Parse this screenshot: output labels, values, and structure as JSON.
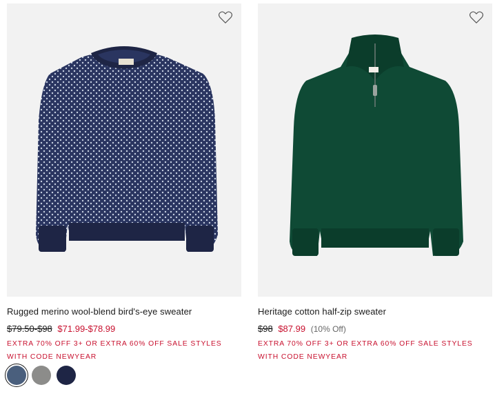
{
  "products": [
    {
      "name": "Rugged merino wool-blend bird's-eye sweater",
      "original_price": "$79.50-$98",
      "sale_price": "$71.99-$78.99",
      "discount": "",
      "promo": "EXTRA 70% OFF 3+ OR EXTRA 60% OFF SALE STYLES WITH CODE NEWYEAR",
      "image_icon": "navy-birdseye-crewneck-sweater-image",
      "swatches": [
        {
          "color": "#4a5f7d",
          "selected": true
        },
        {
          "color": "#8c8c8a",
          "selected": false
        },
        {
          "color": "#1e2545",
          "selected": false
        }
      ]
    },
    {
      "name": "Heritage cotton half-zip sweater",
      "original_price": "$98",
      "sale_price": "$87.99",
      "discount": "(10% Off)",
      "promo": "EXTRA 70% OFF 3+ OR EXTRA 60% OFF SALE STYLES WITH CODE NEWYEAR",
      "image_icon": "green-half-zip-sweater-image",
      "swatches": []
    }
  ],
  "colors": {
    "sale_red": "#c8102e",
    "card_bg": "#f2f2f2",
    "text": "#1a1a1a"
  }
}
